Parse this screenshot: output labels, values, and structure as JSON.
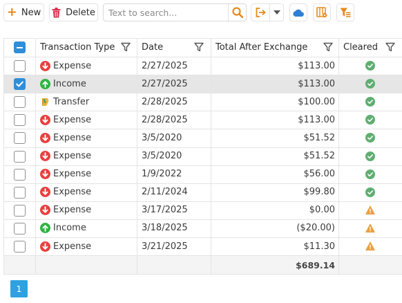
{
  "toolbar": {
    "new_label": "New",
    "delete_label": "Delete",
    "search_placeholder": "Text to search...",
    "icons": [
      "plus-icon",
      "trash-icon",
      "search-icon",
      "export-icon",
      "chevron-down-icon",
      "cloud-icon",
      "column-chooser-icon",
      "filter-settings-icon"
    ],
    "accent_color": "#e58a1f"
  },
  "grid": {
    "columns": {
      "type": "Transaction Type",
      "date": "Date",
      "total": "Total After Exchange",
      "cleared": "Cleared"
    },
    "rows": [
      {
        "selected": false,
        "type": "Expense",
        "type_icon": "arrow-down-icon",
        "date": "2/27/2025",
        "total": "$113.00",
        "cleared": "check"
      },
      {
        "selected": true,
        "type": "Income",
        "type_icon": "arrow-up-icon",
        "date": "2/27/2025",
        "total": "$113.00",
        "cleared": "check"
      },
      {
        "selected": false,
        "type": "Transfer",
        "type_icon": "transfer-icon",
        "date": "2/28/2025",
        "total": "$100.00",
        "cleared": "check"
      },
      {
        "selected": false,
        "type": "Expense",
        "type_icon": "arrow-down-icon",
        "date": "2/28/2025",
        "total": "$113.00",
        "cleared": "check"
      },
      {
        "selected": false,
        "type": "Expense",
        "type_icon": "arrow-down-icon",
        "date": "3/5/2020",
        "total": "$51.52",
        "cleared": "check"
      },
      {
        "selected": false,
        "type": "Expense",
        "type_icon": "arrow-down-icon",
        "date": "3/5/2020",
        "total": "$51.52",
        "cleared": "check"
      },
      {
        "selected": false,
        "type": "Expense",
        "type_icon": "arrow-down-icon",
        "date": "1/9/2022",
        "total": "$56.00",
        "cleared": "check"
      },
      {
        "selected": false,
        "type": "Expense",
        "type_icon": "arrow-down-icon",
        "date": "2/11/2024",
        "total": "$99.80",
        "cleared": "check"
      },
      {
        "selected": false,
        "type": "Expense",
        "type_icon": "arrow-down-icon",
        "date": "3/17/2025",
        "total": "$0.00",
        "cleared": "warning"
      },
      {
        "selected": false,
        "type": "Income",
        "type_icon": "arrow-up-icon",
        "date": "3/18/2025",
        "total": "($20.00)",
        "cleared": "warning"
      },
      {
        "selected": false,
        "type": "Expense",
        "type_icon": "arrow-down-icon",
        "date": "3/21/2025",
        "total": "$11.30",
        "cleared": "warning"
      }
    ],
    "summary_total": "$689.14"
  },
  "pager": {
    "current_page": "1"
  },
  "colors": {
    "expense": "#e8403f",
    "income": "#2fb344",
    "cleared_check": "#5fae72",
    "warning": "#e8a040",
    "selection": "#2f8ed8",
    "pager": "#2fa1e0"
  }
}
